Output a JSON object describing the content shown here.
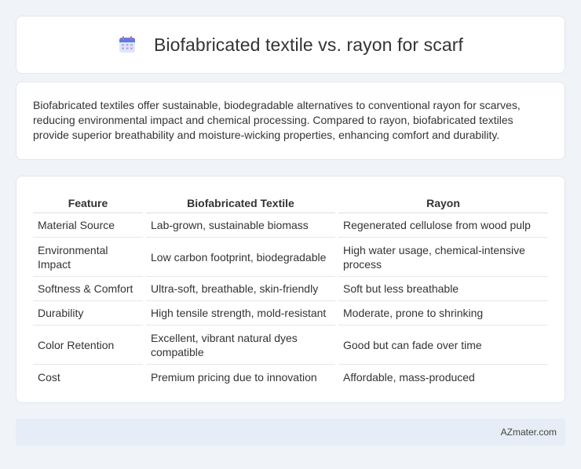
{
  "header": {
    "title": "Biofabricated textile vs. rayon for scarf",
    "icon": "calendar-icon"
  },
  "intro": {
    "text": "Biofabricated textiles offer sustainable, biodegradable alternatives to conventional rayon for scarves, reducing environmental impact and chemical processing. Compared to rayon, biofabricated textiles provide superior breathability and moisture-wicking properties, enhancing comfort and durability."
  },
  "table": {
    "headers": [
      "Feature",
      "Biofabricated Textile",
      "Rayon"
    ],
    "rows": [
      [
        "Material Source",
        "Lab-grown, sustainable biomass",
        "Regenerated cellulose from wood pulp"
      ],
      [
        "Environmental Impact",
        "Low carbon footprint, biodegradable",
        "High water usage, chemical-intensive process"
      ],
      [
        "Softness & Comfort",
        "Ultra-soft, breathable, skin-friendly",
        "Soft but less breathable"
      ],
      [
        "Durability",
        "High tensile strength, mold-resistant",
        "Moderate, prone to shrinking"
      ],
      [
        "Color Retention",
        "Excellent, vibrant natural dyes compatible",
        "Good but can fade over time"
      ],
      [
        "Cost",
        "Premium pricing due to innovation",
        "Affordable, mass-produced"
      ]
    ]
  },
  "footer": {
    "text": "AZmater.com"
  }
}
